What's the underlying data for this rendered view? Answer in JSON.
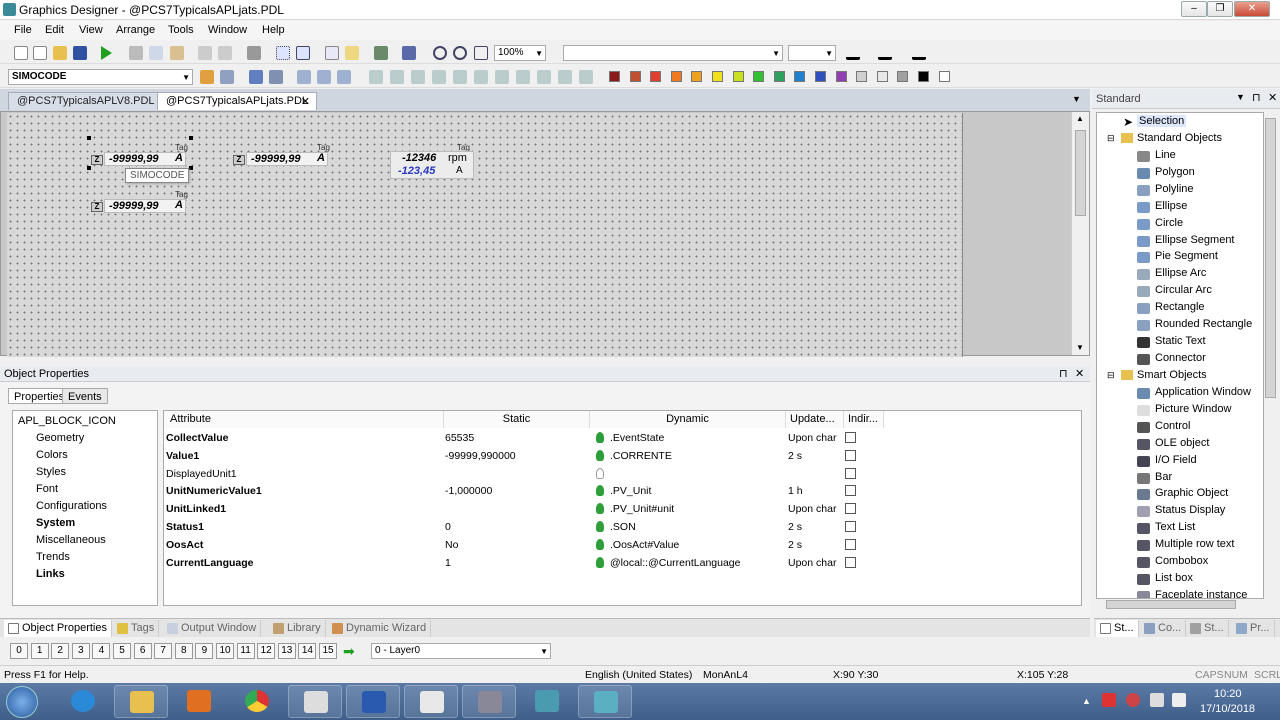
{
  "window": {
    "title": "Graphics Designer - @PCS7TypicalsAPLjats.PDL"
  },
  "menu": [
    "File",
    "Edit",
    "View",
    "Arrange",
    "Tools",
    "Window",
    "Help"
  ],
  "toolbar": {
    "zoom": "100%",
    "object_combo": "SIMOCODE"
  },
  "colors": {
    "palette": [
      "#8b1a1a",
      "#c05030",
      "#e04030",
      "#f07a20",
      "#f0a020",
      "#f0e020",
      "#c8e020",
      "#30c030",
      "#30a060",
      "#2080d0",
      "#3050c0",
      "#9040b0",
      "#d0d0d0",
      "#e8e8e8",
      "#a0a0a0",
      "#000000",
      "#ffffff"
    ]
  },
  "doc_tabs": [
    "@PCS7TypicalsAPLV8.PDL",
    "@PCS7TypicalsAPLjats.PDL"
  ],
  "canvas": {
    "blocks": [
      {
        "tag": "Tag",
        "value": "-99999,99",
        "unit": "A",
        "indicator": "Z"
      },
      {
        "tag": "Tag",
        "value": "-99999,99",
        "unit": "A",
        "indicator": "Z"
      },
      {
        "tag": "Tag",
        "value": "-99999,99",
        "unit": "A",
        "indicator": "Z"
      }
    ],
    "motor": {
      "tag": "Tag",
      "value1": "-12346",
      "unit1": "rpm",
      "value2": "-123,45",
      "unit2": "A"
    },
    "tooltip": "SIMOCODE"
  },
  "object_properties": {
    "title": "Object Properties",
    "tabs": [
      "Properties",
      "Events"
    ],
    "tree_root": "APL_BLOCK_ICON",
    "tree": [
      "Geometry",
      "Colors",
      "Styles",
      "Font",
      "Configurations",
      "System",
      "Miscellaneous",
      "Trends",
      "Links"
    ],
    "columns": [
      "Attribute",
      "Static",
      "Dynamic",
      "Update...",
      "Indir..."
    ],
    "rows": [
      {
        "attribute": "CollectValue",
        "static": "65535",
        "dynamic": ".EventState",
        "update": "Upon char"
      },
      {
        "attribute": "Value1",
        "static": "-99999,990000",
        "dynamic": ".CORRENTE",
        "update": "2 s"
      },
      {
        "attribute": "DisplayedUnit1",
        "static": "",
        "dynamic": "",
        "update": ""
      },
      {
        "attribute": "UnitNumericValue1",
        "static": "-1,000000",
        "dynamic": ".PV_Unit",
        "update": "1 h"
      },
      {
        "attribute": "UnitLinked1",
        "static": "",
        "dynamic": ".PV_Unit#unit",
        "update": "Upon char"
      },
      {
        "attribute": "Status1",
        "static": "0",
        "dynamic": ".SON",
        "update": "2 s"
      },
      {
        "attribute": "OosAct",
        "static": "No",
        "dynamic": ".OosAct#Value",
        "update": "2 s"
      },
      {
        "attribute": "CurrentLanguage",
        "static": "1",
        "dynamic": "@local::@CurrentLanguage",
        "update": "Upon char"
      }
    ]
  },
  "bottom_tabs": [
    "Object Properties",
    "Tags",
    "Output Window",
    "Library",
    "Dynamic Wizard"
  ],
  "layers": {
    "buttons": [
      "0",
      "1",
      "2",
      "3",
      "4",
      "5",
      "6",
      "7",
      "8",
      "9",
      "10",
      "11",
      "12",
      "13",
      "14",
      "15"
    ],
    "current": "0 - Layer0"
  },
  "status": {
    "help": "Press F1 for Help.",
    "language": "English (United States)",
    "object": "MonAnL4",
    "pos": "X:90 Y:30",
    "size": "X:105 Y:28",
    "caps": "CAPS",
    "num": "NUM",
    "scrl": "SCRL"
  },
  "standard_panel": {
    "title": "Standard",
    "selection": "Selection",
    "group1": "Standard Objects",
    "items1": [
      "Line",
      "Polygon",
      "Polyline",
      "Ellipse",
      "Circle",
      "Ellipse Segment",
      "Pie Segment",
      "Ellipse Arc",
      "Circular Arc",
      "Rectangle",
      "Rounded Rectangle",
      "Static Text",
      "Connector"
    ],
    "group2": "Smart Objects",
    "items2": [
      "Application Window",
      "Picture Window",
      "Control",
      "OLE object",
      "I/O Field",
      "Bar",
      "Graphic Object",
      "Status Display",
      "Text List",
      "Multiple row text",
      "Combobox",
      "List box",
      "Faceplate instance"
    ],
    "tabs": [
      "St...",
      "Co...",
      "St...",
      "Pr..."
    ]
  },
  "taskbar": {
    "time": "10:20",
    "date": "17/10/2018"
  }
}
